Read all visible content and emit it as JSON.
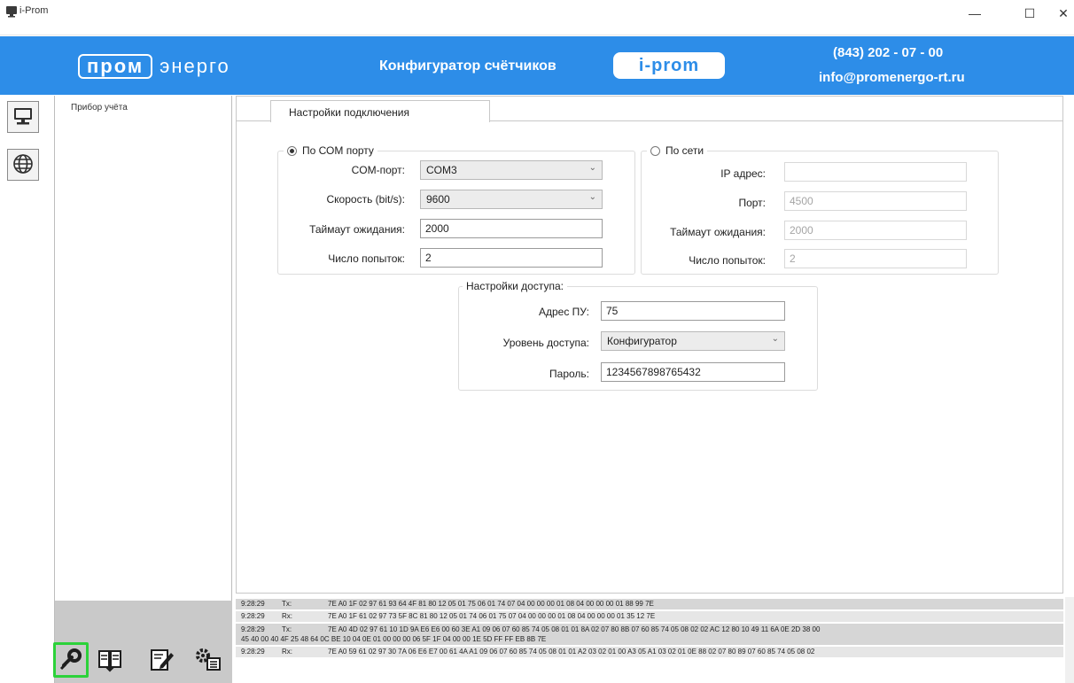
{
  "window": {
    "title": "i-Prom",
    "controls": {
      "minimize": "—",
      "maximize": "☐",
      "close": "✕"
    }
  },
  "header": {
    "logo_boxed": "пром",
    "logo_rest": "энерго",
    "app_name": "Конфигуратор счётчиков",
    "badge": "i-prom",
    "phone": "(843) 202 - 07 - 00",
    "email": "info@promenergo-rt.ru",
    "banner_color": "#2d8de8"
  },
  "sidebar": {
    "buttons": [
      {
        "icon": "monitor-icon"
      },
      {
        "icon": "globe-icon"
      }
    ]
  },
  "tree": {
    "title": "Прибор учёта"
  },
  "toolbar": {
    "tools": [
      {
        "icon": "connect-icon",
        "active": true
      },
      {
        "icon": "read-data-icon"
      },
      {
        "icon": "edit-icon"
      },
      {
        "icon": "settings-list-icon"
      }
    ],
    "active_color": "#2cd23a"
  },
  "tabs": [
    {
      "label": "Настройки подключения",
      "active": true
    }
  ],
  "com": {
    "legend": "По СОМ порту",
    "selected": true,
    "port_label": "COM-порт:",
    "port_value": "COM3",
    "speed_label": "Скорость (bit/s):",
    "speed_value": "9600",
    "timeout_label": "Таймаут ожидания:",
    "timeout_value": "2000",
    "attempts_label": "Число попыток:",
    "attempts_value": "2"
  },
  "net": {
    "legend": "По сети",
    "selected": false,
    "ip_label": "IP адрес:",
    "ip_value": "",
    "port_label": "Порт:",
    "port_value": "4500",
    "timeout_label": "Таймаут ожидания:",
    "timeout_value": "2000",
    "attempts_label": "Число попыток:",
    "attempts_value": "2"
  },
  "access": {
    "legend": "Настройки доступа:",
    "address_label": "Адрес ПУ:",
    "address_value": "75",
    "level_label": "Уровень доступа:",
    "level_value": "Конфигуратор",
    "password_label": "Пароль:",
    "password_value": "1234567898765432"
  },
  "log": [
    {
      "time": "9:28:29",
      "dir": "Tx:",
      "data": "7E A0 1F 02 97 61 93 64 4F 81 80 12 05 01 75 06 01 74 07 04 00 00 00 01 08 04 00 00 00 01 88 99 7E"
    },
    {
      "time": "9:28:29",
      "dir": "Rx:",
      "data": "7E A0 1F 61 02 97 73 5F 8C 81 80 12 05 01 74 06 01 75 07 04 00 00 00 01 08 04 00 00 00 01 35 12 7E"
    },
    {
      "time": "9:28:29",
      "dir": "Tx:",
      "data": "7E A0 4D 02 97 61 10 1D 9A E6 E6 00 60 3E A1 09 06 07 60 85 74 05 08 01 01 8A 02 07 80 8B 07 60 85 74 05 08 02 02 AC 12 80 10 49 11 6A 0E 2D 38 00",
      "cont": "45 40 00 40 4F 25 48 64 0C BE 10 04 0E 01 00 00 00 06 5F 1F 04 00 00 1E 5D FF FF EB 8B 7E"
    },
    {
      "time": "9:28:29",
      "dir": "Rx:",
      "data": "7E A0 59 61 02 97 30 7A 06 E6 E7 00 61 4A A1 09 06 07 60 85 74 05 08 01 01 A2 03 02 01 00 A3 05 A1 03 02 01 0E 88 02 07 80 89 07 60 85 74 05 08 02"
    }
  ]
}
